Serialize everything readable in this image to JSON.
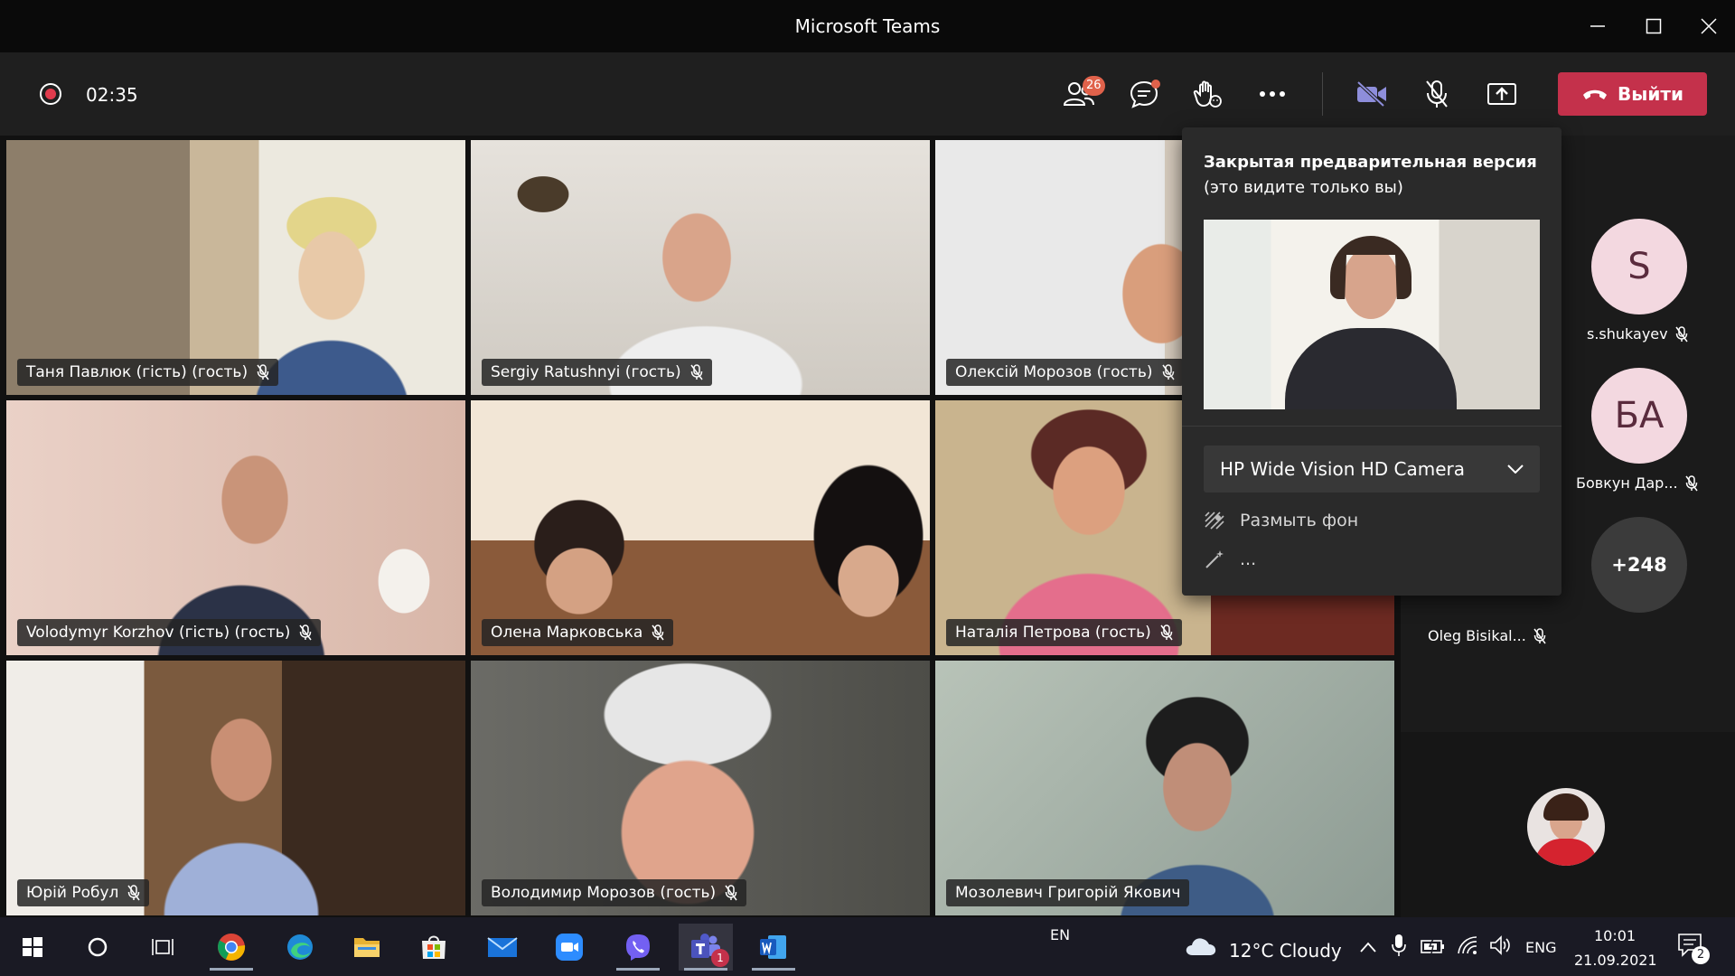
{
  "window": {
    "title": "Microsoft Teams"
  },
  "toolbar": {
    "timer": "02:35",
    "participants_badge": "26",
    "leave_label": "Выйти",
    "colors": {
      "leave": "#c4314b",
      "record": "#e23b4d",
      "badge": "#e0624b"
    }
  },
  "tiles": [
    {
      "name": "Таня Павлюк (гість) (гость)"
    },
    {
      "name": "Sergiy Ratushnyi (гость)"
    },
    {
      "name": "Олексій Морозов (гость)"
    },
    {
      "name": "Volodymyr Korzhov (гість) (гость)"
    },
    {
      "name": "Олена Марковська"
    },
    {
      "name": "Наталія Петрова (гость)"
    },
    {
      "name": "Юрій Робул"
    },
    {
      "name": "Володимир Морозов (гость)"
    },
    {
      "name": "Мозолевич Григорій Якович"
    }
  ],
  "roster": {
    "people": [
      {
        "initials": "S",
        "name": "s.shukayev"
      },
      {
        "initials": "БА",
        "name": "Бовкун Дар..."
      }
    ],
    "more_count": "+248",
    "hidden_name": "Oleg Bisikal..."
  },
  "popup": {
    "title": "Закрытая предварительная версия",
    "subtitle": "(это видите только вы)",
    "camera": "HP Wide Vision HD Camera",
    "blur_label": "Размыть фон",
    "effects_label": "..."
  },
  "taskbar": {
    "input_lang_indicator": "EN",
    "weather": "12°C  Cloudy",
    "lang": "ENG",
    "time": "10:01",
    "date": "21.09.2021",
    "notifications_count": "2",
    "teams_badge": "1"
  }
}
